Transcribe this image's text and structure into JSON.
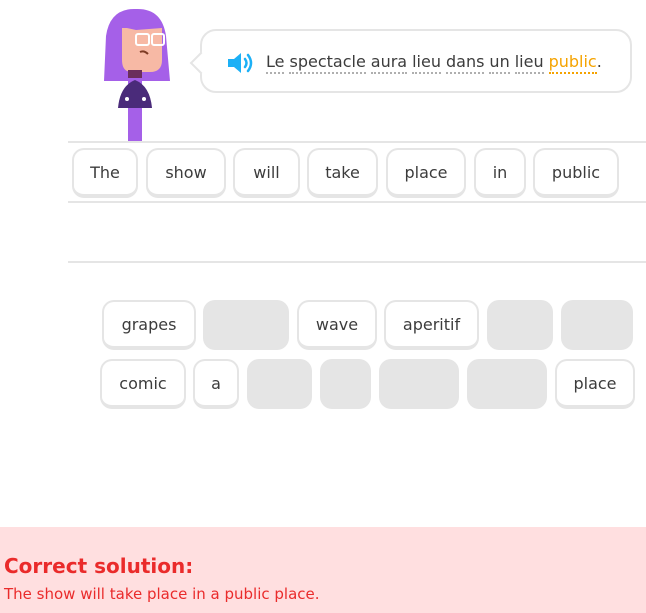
{
  "prompt": {
    "words": [
      {
        "text": "Le",
        "highlight": false
      },
      {
        "text": "spectacle",
        "highlight": false
      },
      {
        "text": "aura",
        "highlight": false
      },
      {
        "text": "lieu",
        "highlight": false
      },
      {
        "text": "dans",
        "highlight": false
      },
      {
        "text": "un",
        "highlight": false
      },
      {
        "text": "lieu",
        "highlight": false
      },
      {
        "text": "public",
        "highlight": true
      }
    ],
    "punctuation": "."
  },
  "answer": {
    "tiles": [
      "The",
      "show",
      "will",
      "take",
      "place",
      "in",
      "public"
    ]
  },
  "word_bank": {
    "row1": [
      {
        "text": "grapes",
        "used": false
      },
      {
        "text": "",
        "used": true
      },
      {
        "text": "wave",
        "used": false
      },
      {
        "text": "aperitif",
        "used": false
      },
      {
        "text": "",
        "used": true
      },
      {
        "text": "",
        "used": true
      }
    ],
    "row2": [
      {
        "text": "comic",
        "used": false
      },
      {
        "text": "a",
        "used": false
      },
      {
        "text": "",
        "used": true
      },
      {
        "text": "",
        "used": true
      },
      {
        "text": "",
        "used": true
      },
      {
        "text": "",
        "used": true
      },
      {
        "text": "place",
        "used": false
      }
    ]
  },
  "footer": {
    "title": "Correct solution:",
    "solution": "The show will take place in a public place."
  },
  "colors": {
    "accent": "#f5a300",
    "speaker": "#1cb0f6",
    "character_hair": "#a560e8",
    "error_text": "#ea2b2b",
    "error_bg": "#ffdfe0"
  }
}
